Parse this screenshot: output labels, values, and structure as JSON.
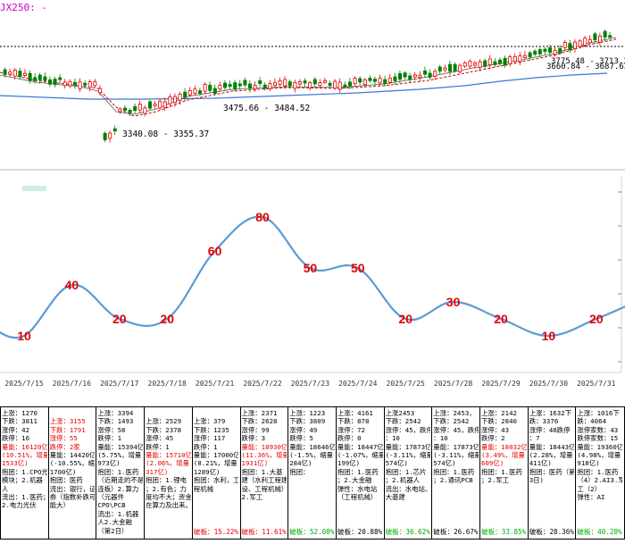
{
  "kline": {
    "title": "JX250: -",
    "annotations": [
      "3775.48 - 3713.37",
      "3660.84 - 3687.63",
      "3475.66 - 3484.52",
      "3340.08 - 3355.37"
    ]
  },
  "chart_data": {
    "type": "line",
    "categories": [
      "2025/7/15",
      "2025/7/16",
      "2025/7/17",
      "2025/7/18",
      "2025/7/21",
      "2025/7/22",
      "2025/7/23",
      "2025/7/24",
      "2025/7/25",
      "2025/7/28",
      "2025/7/29",
      "2025/7/30",
      "2025/7/31"
    ],
    "values": [
      10,
      40,
      20,
      20,
      60,
      80,
      50,
      50,
      20,
      30,
      20,
      10,
      20
    ],
    "data_labels": [
      "10",
      "40",
      "20",
      "20",
      "60",
      "80",
      "50",
      "50",
      "20",
      "30",
      "20",
      "10",
      "20"
    ],
    "ylim": [
      0,
      100
    ],
    "color": "#5b9bd5",
    "label_color": "#e60000",
    "grid": false
  },
  "table": [
    {
      "lines": [
        {
          "t": "上涨：1270"
        },
        {
          "t": "下跌：3811"
        },
        {
          "t": "涨停：42"
        },
        {
          "t": "跌停：16"
        },
        {
          "t": "量能：16120亿",
          "c": "red"
        },
        {
          "t": "(10.51%，增量",
          "c": "red"
        },
        {
          "t": "1533亿)",
          "c": "red"
        },
        {
          "t": "抱团：1.CPO光"
        },
        {
          "t": "模块；2.机器"
        },
        {
          "t": "人"
        },
        {
          "t": "流出：1.医药；"
        },
        {
          "t": "2.电力光伏"
        }
      ],
      "footer": ""
    },
    {
      "lines": [
        {
          "t": ""
        },
        {
          "t": "上涨：3155",
          "c": "red"
        },
        {
          "t": "下跌：1791",
          "c": "red"
        },
        {
          "t": "涨停：55",
          "c": "red"
        },
        {
          "t": "跌停：2家",
          "c": "red"
        },
        {
          "t": "量能：14420亿"
        },
        {
          "t": "(-10.55%，缩量"
        },
        {
          "t": "1700亿)"
        },
        {
          "t": "抱团：医药"
        },
        {
          "t": "流出：银行，证"
        },
        {
          "t": "券（指数补跌可"
        },
        {
          "t": "能大）"
        }
      ],
      "footer": ""
    },
    {
      "lines": [
        {
          "t": "上涨：3394"
        },
        {
          "t": "下跌：1493"
        },
        {
          "t": "涨停：58"
        },
        {
          "t": "跌停：1"
        },
        {
          "t": "量能：15394亿"
        },
        {
          "t": "(5.75%，增量"
        },
        {
          "t": "973亿)"
        },
        {
          "t": "抱团：1.医药"
        },
        {
          "t": "（近期走的不是"
        },
        {
          "t": "连板）2.算力"
        },
        {
          "t": "（元器件"
        },
        {
          "t": "CPO\\PCB"
        },
        {
          "t": "流出：1.机器"
        },
        {
          "t": "人2.大金融"
        },
        {
          "t": "（第2日）"
        }
      ],
      "footer": ""
    },
    {
      "lines": [
        {
          "t": ""
        },
        {
          "t": "上涨：2529"
        },
        {
          "t": "下跌：2378"
        },
        {
          "t": "涨停：45"
        },
        {
          "t": "跌停：1"
        },
        {
          "t": "量能：15710亿",
          "c": "red"
        },
        {
          "t": "(2.06%，增量",
          "c": "red"
        },
        {
          "t": "317亿)",
          "c": "red"
        },
        {
          "t": "抱团：1.锂电"
        },
        {
          "t": "；2.有色；力"
        },
        {
          "t": "度均不大；资金"
        },
        {
          "t": "在算力及出来。"
        }
      ],
      "footer": ""
    },
    {
      "lines": [
        {
          "t": ""
        },
        {
          "t": "上涨：379"
        },
        {
          "t": "下跌：1235"
        },
        {
          "t": "涨停：117"
        },
        {
          "t": "跌停：1"
        },
        {
          "t": "量能：17000亿"
        },
        {
          "t": "(8.21%，增量"
        },
        {
          "t": "1289亿)"
        },
        {
          "t": "抱团：水利，工"
        },
        {
          "t": "程机械"
        }
      ],
      "footer": "破板：15.22%",
      "footer_c": "red"
    },
    {
      "lines": [
        {
          "t": "上涨：2371"
        },
        {
          "t": "下跌：2628"
        },
        {
          "t": "涨停：99"
        },
        {
          "t": "跌停：3"
        },
        {
          "t": "量能：18930亿",
          "c": "red"
        },
        {
          "t": "(11.36%，增量",
          "c": "red"
        },
        {
          "t": "1931亿)",
          "c": "red"
        },
        {
          "t": "抱团：1.大基"
        },
        {
          "t": "建（水利工程建"
        },
        {
          "t": "设、工程机械）"
        },
        {
          "t": "2.军工"
        }
      ],
      "footer": "破板：11.61%",
      "footer_c": "red"
    },
    {
      "lines": [
        {
          "t": "上涨：1223"
        },
        {
          "t": "下跌：3809"
        },
        {
          "t": "涨停：49"
        },
        {
          "t": "跌停：5"
        },
        {
          "t": "量能：18646亿"
        },
        {
          "t": "(-1.5%，缩量"
        },
        {
          "t": "284亿)"
        },
        {
          "t": "抱团："
        }
      ],
      "footer": "破板：52.08%",
      "footer_c": "green"
    },
    {
      "lines": [
        {
          "t": "上涨：4161"
        },
        {
          "t": "下跌：878"
        },
        {
          "t": "涨停：72"
        },
        {
          "t": "跌停：0"
        },
        {
          "t": "量能：18447亿"
        },
        {
          "t": "(-1.07%，缩量"
        },
        {
          "t": "199亿)"
        },
        {
          "t": "抱团：1.医药"
        },
        {
          "t": "；2.大金融"
        },
        {
          "t": "弹性：水电站"
        },
        {
          "t": "（工程机械）"
        }
      ],
      "footer": "破板：20.88%",
      "footer_c": ""
    },
    {
      "lines": [
        {
          "t": "上涨2453"
        },
        {
          "t": "下跌：2542"
        },
        {
          "t": "涨停：45，跌停"
        },
        {
          "t": "：10"
        },
        {
          "t": "量能：17873亿"
        },
        {
          "t": "(-3.11%，缩量"
        },
        {
          "t": "574亿)"
        },
        {
          "t": "抱团：1.芯片"
        },
        {
          "t": "；2.机器人"
        },
        {
          "t": "流出：水电站、"
        },
        {
          "t": "大基建"
        }
      ],
      "footer": "破板：36.62%",
      "footer_c": "green"
    },
    {
      "lines": [
        {
          "t": "上涨：2453，"
        },
        {
          "t": "下跌：2542"
        },
        {
          "t": "涨停：45，跌停"
        },
        {
          "t": "：10"
        },
        {
          "t": "量能：17873亿"
        },
        {
          "t": "(-3.11%，缩量"
        },
        {
          "t": "574亿)"
        },
        {
          "t": "抱团：1.医药"
        },
        {
          "t": "；2.通讯PCB"
        }
      ],
      "footer": "破板：26.67%",
      "footer_c": ""
    },
    {
      "lines": [
        {
          "t": "上涨：2142"
        },
        {
          "t": "下跌：2840"
        },
        {
          "t": "涨停：43"
        },
        {
          "t": "跌停：2"
        },
        {
          "t": "量能：18032亿",
          "c": "red"
        },
        {
          "t": "(3.49%，增量",
          "c": "red"
        },
        {
          "t": "609亿)",
          "c": "red"
        },
        {
          "t": "抱团：1.医药"
        },
        {
          "t": "；2.军工"
        }
      ],
      "footer": "破板：33.85%",
      "footer_c": "green"
    },
    {
      "lines": [
        {
          "t": "上涨：1632下"
        },
        {
          "t": "跌：3376"
        },
        {
          "t": "涨停：48跌停"
        },
        {
          "t": "：7"
        },
        {
          "t": "量能：18443亿"
        },
        {
          "t": "(2.28%，增量"
        },
        {
          "t": "411亿)"
        },
        {
          "t": "抱团：医药（第"
        },
        {
          "t": "3日)"
        }
      ],
      "footer": "破板：28.36%",
      "footer_c": ""
    },
    {
      "lines": [
        {
          "t": "上涨：1016下"
        },
        {
          "t": "跌：4064"
        },
        {
          "t": "涨停家数：43"
        },
        {
          "t": "跌停家数：15"
        },
        {
          "t": "量能：19360亿"
        },
        {
          "t": "(4.98%，增量"
        },
        {
          "t": "918亿)"
        },
        {
          "t": "抱团：1.医药"
        },
        {
          "t": "（4）2.AI3.军"
        },
        {
          "t": "工（2）"
        },
        {
          "t": "弹性：AI"
        }
      ],
      "footer": "破板：40.28%",
      "footer_c": "green"
    }
  ]
}
